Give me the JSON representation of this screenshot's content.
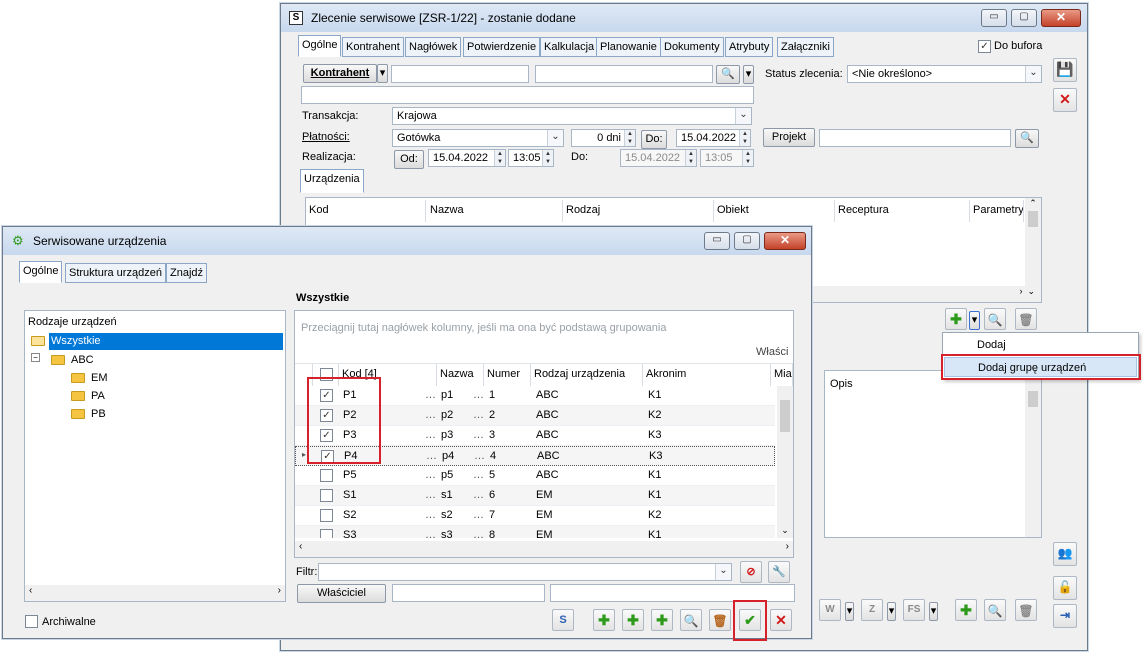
{
  "main_window": {
    "title": "Zlecenie serwisowe [ZSR-1/22]  - zostanie dodane",
    "app_icon": "S",
    "tabs": [
      "Ogólne",
      "Kontrahent",
      "Nagłówek",
      "Potwierdzenie",
      "Kalkulacja",
      "Planowanie",
      "Dokumenty",
      "Atrybuty",
      "Załączniki"
    ],
    "do_bufora_label": "Do bufora",
    "kontrahent_button": "Kontrahent",
    "status_label": "Status zlecenia:",
    "status_value": "<Nie określono>",
    "transakcja_label": "Transakcja:",
    "transakcja_value": "Krajowa",
    "platnosci_label": "Płatności:",
    "platnosci_value": "Gotówka",
    "dni_value": "0 dni",
    "do_button": "Do:",
    "do_date": "15.04.2022",
    "projekt_button": "Projekt",
    "realizacja_label": "Realizacja:",
    "od_button": "Od:",
    "od_date": "15.04.2022",
    "od_time": "13:05",
    "do_label2": "Do:",
    "do2_date": "15.04.2022",
    "do2_time": "13:05",
    "urzadzenia_tab": "Urządzenia",
    "grid_headers": [
      "Kod",
      "Nazwa",
      "Rodzaj",
      "Obiekt",
      "Receptura",
      "Parametry"
    ],
    "opis_header": "Opis",
    "dropdown_menu": [
      "Dodaj",
      "Dodaj grupę urządzeń"
    ]
  },
  "dialog": {
    "title": "Serwisowane urządzenia",
    "tabs": [
      "Ogólne",
      "Struktura urządzeń",
      "Znajdź"
    ],
    "tree_header": "Rodzaje urządzeń",
    "tree": [
      "Wszystkie",
      "ABC",
      "EM",
      "PA",
      "PB"
    ],
    "section_title": "Wszystkie",
    "group_hint": "Przeciągnij tutaj nagłówek kolumny, jeśli ma ona być podstawą grupowania",
    "band_label": "Właści",
    "columns": [
      "Kod [4]",
      "Nazwa",
      "Numer",
      "Rodzaj urządzenia",
      "Akronim",
      "Mia"
    ],
    "rows": [
      {
        "checked": true,
        "kod": "P1",
        "nazwa": "p1",
        "numer": "1",
        "rodzaj": "ABC",
        "akronim": "K1"
      },
      {
        "checked": true,
        "kod": "P2",
        "nazwa": "p2",
        "numer": "2",
        "rodzaj": "ABC",
        "akronim": "K2"
      },
      {
        "checked": true,
        "kod": "P3",
        "nazwa": "p3",
        "numer": "3",
        "rodzaj": "ABC",
        "akronim": "K3"
      },
      {
        "checked": true,
        "kod": "P4",
        "nazwa": "p4",
        "numer": "4",
        "rodzaj": "ABC",
        "akronim": "K3"
      },
      {
        "checked": false,
        "kod": "P5",
        "nazwa": "p5",
        "numer": "5",
        "rodzaj": "ABC",
        "akronim": "K1"
      },
      {
        "checked": false,
        "kod": "S1",
        "nazwa": "s1",
        "numer": "6",
        "rodzaj": "EM",
        "akronim": "K1"
      },
      {
        "checked": false,
        "kod": "S2",
        "nazwa": "s2",
        "numer": "7",
        "rodzaj": "EM",
        "akronim": "K2"
      },
      {
        "checked": false,
        "kod": "S3",
        "nazwa": "s3",
        "numer": "8",
        "rodzaj": "EM",
        "akronim": "K1"
      }
    ],
    "filtr_label": "Filtr:",
    "wlasciciel_button": "Właściciel",
    "archiwalne_label": "Archiwalne"
  },
  "colors": {
    "accent": "#0078d7",
    "highlight_box": "#d6212a",
    "titlebar": "#c7d8ee"
  }
}
